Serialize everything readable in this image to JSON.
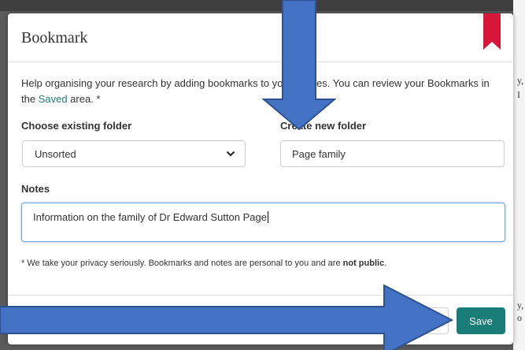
{
  "modal": {
    "title": "Bookmark",
    "intro_before": "Help organising your research by adding bookmar",
    "intro_hidden": "ks to y",
    "intro_after": "our articles. You can review your Bookmarks in the ",
    "intro_link": "Saved",
    "intro_end": " area. *",
    "icons": {
      "bookmark": "bookmark-ribbon-icon",
      "chevron": "chevron-down-icon"
    },
    "accent_color": "#1a7d78"
  },
  "existing_folder": {
    "label": "Choose existing folder",
    "selected": "Unsorted"
  },
  "new_folder": {
    "label": "Create new folder",
    "value": "Page family"
  },
  "notes": {
    "label": "Notes",
    "value": "Information on the family of Dr Edward Sutton Page"
  },
  "privacy": {
    "text": "* We take your privacy seriously. Bookmarks and notes are personal to you and are ",
    "emphasis": "not public",
    "end": "."
  },
  "footer": {
    "save_label": "Save"
  },
  "background": {
    "right_chars": [
      "y,",
      "I",
      "y,",
      "o"
    ]
  }
}
